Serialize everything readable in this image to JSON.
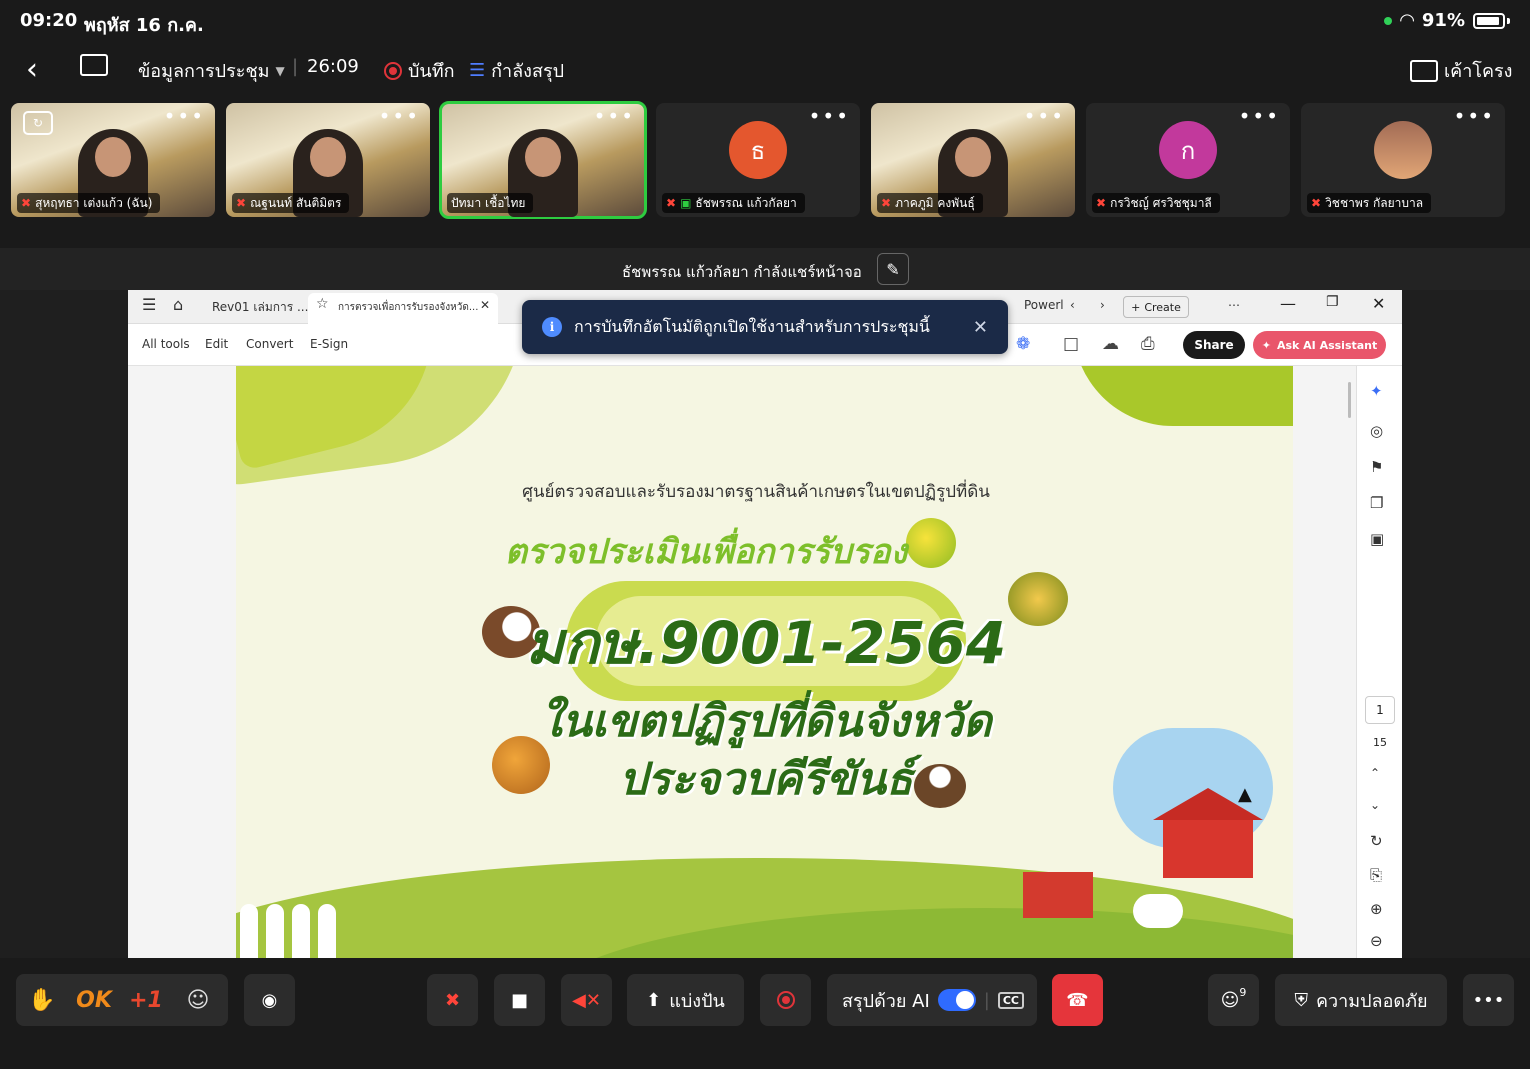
{
  "status_bar": {
    "time": "09:20",
    "date": "พฤหัส 16 ก.ค.",
    "battery": "91%"
  },
  "meeting_bar": {
    "info_label": "ข้อมูลการประชุม",
    "timer": "26:09",
    "record_label": "บันทึก",
    "summary_label": "กำลังสรุป",
    "layout_label": "เค้าโครง"
  },
  "participants": [
    {
      "name": "สุหฤทธา เต่งแก้ว (ฉัน)",
      "video": true
    },
    {
      "name": "ณฐนนท์ สันติมิตร",
      "video": true
    },
    {
      "name": "ปัทมา เชื้อไทย",
      "video": true,
      "active": true
    },
    {
      "name": "ธัชพรรณ แก้วกัลยา",
      "video": false,
      "initial": "ธ",
      "color": "#e4572e"
    },
    {
      "name": "ภาคภูมิ คงพันธุ์",
      "video": true
    },
    {
      "name": "กรวิชญ์ ศรวิชชุมาลี",
      "video": false,
      "initial": "ก",
      "color": "#c2399c"
    },
    {
      "name": "วิชชาพร กัลยาบาล",
      "video": false,
      "initial": "",
      "color": "#8b6a5a"
    }
  ],
  "share_label": "ธัชพรรณ แก้วกัลยา กำลังแชร์หน้าจอ",
  "toast": "การบันทึกอัตโนมัติถูกเปิดใช้งานสำหรับการประชุมนี้",
  "browser": {
    "tab1": "Rev01 เล่มการ ...",
    "tab2": "การตรวจเพื่อการรับรองจังหวัด...",
    "tab3": "Powerl",
    "create": "Create"
  },
  "app_toolbar": {
    "menu": [
      "All tools",
      "Edit",
      "Convert",
      "E-Sign"
    ],
    "share": "Share",
    "ai": "Ask AI Assistant"
  },
  "document": {
    "heading": "ศูนย์ตรวจสอบและรับรองมาตรฐานสินค้าเกษตรในเขตปฏิรูปที่ดิน",
    "subtitle": "ตรวจประเมินเพื่อการรับรอง",
    "code": "มกษ.9001-2564",
    "line2": "ในเขตปฏิรูปที่ดินจังหวัด",
    "line3": "ประจวบคีรีขันธ์"
  },
  "pager": {
    "current": "1",
    "total": "15"
  },
  "bottom_bar": {
    "ok": "OK",
    "plus_one": "+1",
    "share_label": "แบ่งปัน",
    "ai_summary": "สรุปด้วย AI",
    "cc": "CC",
    "participants_count": "9",
    "security": "ความปลอดภัย"
  },
  "colors": {
    "accent_green": "#2ecc40",
    "record_red": "#e0343a",
    "hangup": "#e5353b",
    "toggle_blue": "#2f6bff"
  }
}
